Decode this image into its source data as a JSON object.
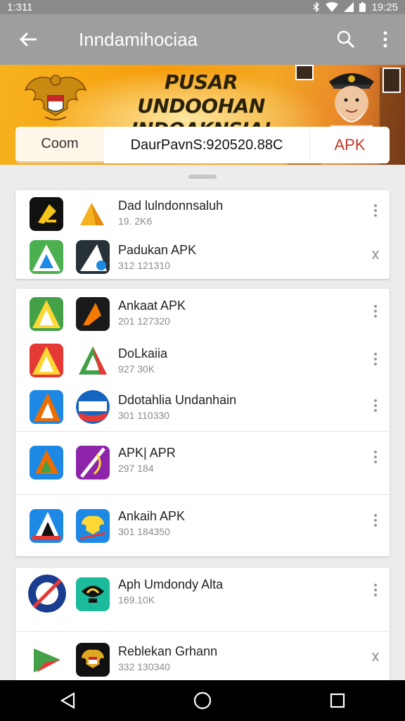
{
  "status_bar": {
    "time": "1:311",
    "right_time": "19:25"
  },
  "app_bar": {
    "title": "Inndamihociaa",
    "icons": [
      "back-arrow-icon",
      "search-icon",
      "more-vert-icon"
    ]
  },
  "banner": {
    "headline_line1": "PUSAR UNDOOHAN",
    "headline_line2": "INDOAKNSIA!",
    "tab_left": "Coom",
    "tab_mid": "DaurPavnS:920520.88C",
    "tab_right": "APK",
    "colors": {
      "accent": "#f5a10e",
      "apk_red": "#c0392b"
    }
  },
  "cards": [
    {
      "rows": [
        {
          "name": "Dad lulndonnsaluh",
          "sub": "19. 2K6",
          "icon1": "black-yellow-logo-icon",
          "icon2": "yellow-triangle-icon",
          "more": "more-vert-icon"
        },
        {
          "name": "Padukan APK",
          "sub": "312 121310",
          "icon1": "green-blue-triangle-icon",
          "icon2": "dark-white-triangle-icon",
          "more": "reorder-icon"
        }
      ]
    },
    {
      "rows": [
        {
          "name": "Ankaat APK",
          "sub": "201 127320",
          "icon1": "green-yellow-a-icon",
          "icon2": "black-orange-logo-icon",
          "more": "more-vert-icon"
        },
        {
          "name": "DoLkaiia",
          "sub": "927 30K",
          "icon1": "red-yellow-a-icon",
          "icon2": "white-green-triangle-icon",
          "more": "more-vert-icon"
        },
        {
          "name": "Ddotahlia Undanhain",
          "sub": "301 110330",
          "icon1": "blue-orange-a-icon",
          "icon2": "blue-red-round-icon",
          "more": "more-vert-icon"
        },
        {
          "name": "APK| APR",
          "sub": "297 184",
          "icon1": "blue-orange-play-icon",
          "icon2": "purple-slash-icon",
          "more": "more-vert-icon"
        },
        {
          "name": "Ankaih APK",
          "sub": "301 184350",
          "icon1": "blue-black-a-icon",
          "icon2": "blue-yellow-emblem-icon",
          "more": "more-vert-icon"
        }
      ]
    },
    {
      "rows": [
        {
          "name": "Aph Umdondy Alta",
          "sub": "169.10K",
          "icon1": "blue-red-circle-icon",
          "icon2": "teal-black-logo-icon",
          "more": "more-vert-icon"
        },
        {
          "name": "Reblekan Grhann",
          "sub": "332 130340",
          "icon1": "green-red-play-icon",
          "icon2": "black-gold-emblem-icon",
          "more": "reorder-icon"
        }
      ]
    }
  ],
  "nav_bar": {
    "icons": [
      "back-triangle-icon",
      "home-circle-icon",
      "recents-square-icon"
    ]
  }
}
